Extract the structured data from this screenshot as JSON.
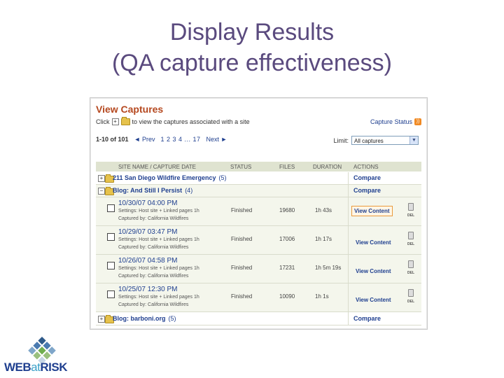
{
  "slide": {
    "title_line1": "Display Results",
    "title_line2": "(QA capture effectiveness)"
  },
  "panel": {
    "title": "View Captures",
    "click_pre": "Click",
    "click_post": "to view the captures associated with a site",
    "capture_status": "Capture Status",
    "pager_range": "1-10 of 101",
    "pager_prev": "◄ Prev",
    "pager_pages": "1 2 3 4 ... 17",
    "pager_next": "Next ►",
    "limit_label": "Limit:",
    "limit_value": "All captures"
  },
  "columns": [
    "SITE NAME / CAPTURE DATE",
    "STATUS",
    "FILES",
    "DURATION",
    "ACTIONS"
  ],
  "sites": [
    {
      "name": "211 San Diego Wildfire Emergency",
      "count": "(5)",
      "action": "Compare",
      "toggle": "+"
    },
    {
      "name": "Blog: And Still I Persist",
      "count": "(4)",
      "action": "Compare",
      "toggle": "−"
    },
    {
      "name": "Blog: barboni.org",
      "count": "(5)",
      "action": "Compare",
      "toggle": "+"
    }
  ],
  "captures": [
    {
      "date": "10/30/07 04:00 PM",
      "settings": "Settings: Host site + Linked pages 1h",
      "captured_by": "Captured by: California Wildfires",
      "status": "Finished",
      "files": "19680",
      "duration": "1h 43s",
      "action": "View Content",
      "delete": "DEL",
      "highlight": true
    },
    {
      "date": "10/29/07 03:47 PM",
      "settings": "Settings: Host site + Linked pages 1h",
      "captured_by": "Captured by: California Wildfires",
      "status": "Finished",
      "files": "17006",
      "duration": "1h 17s",
      "action": "View Content",
      "delete": "DEL",
      "highlight": false
    },
    {
      "date": "10/26/07 04:58 PM",
      "settings": "Settings: Host site + Linked pages 1h",
      "captured_by": "Captured by: California Wildfires",
      "status": "Finished",
      "files": "17231",
      "duration": "1h 5m 19s",
      "action": "View Content",
      "delete": "DEL",
      "highlight": false
    },
    {
      "date": "10/25/07 12:30 PM",
      "settings": "Settings: Host site + Linked pages 1h",
      "captured_by": "Captured by: California Wildfires",
      "status": "Finished",
      "files": "10090",
      "duration": "1h 1s",
      "action": "View Content",
      "delete": "DEL",
      "highlight": false
    }
  ],
  "logo": {
    "text_a": "WEB",
    "text_b": "at",
    "text_c": "RISK"
  },
  "colors": {
    "title": "#5a4a7e",
    "heading": "#b5481f",
    "link": "#1f3f8f",
    "header_bg": "#dfe3d0",
    "row_alt_bg": "#f4f6ec",
    "highlight_border": "#e99a3c"
  }
}
